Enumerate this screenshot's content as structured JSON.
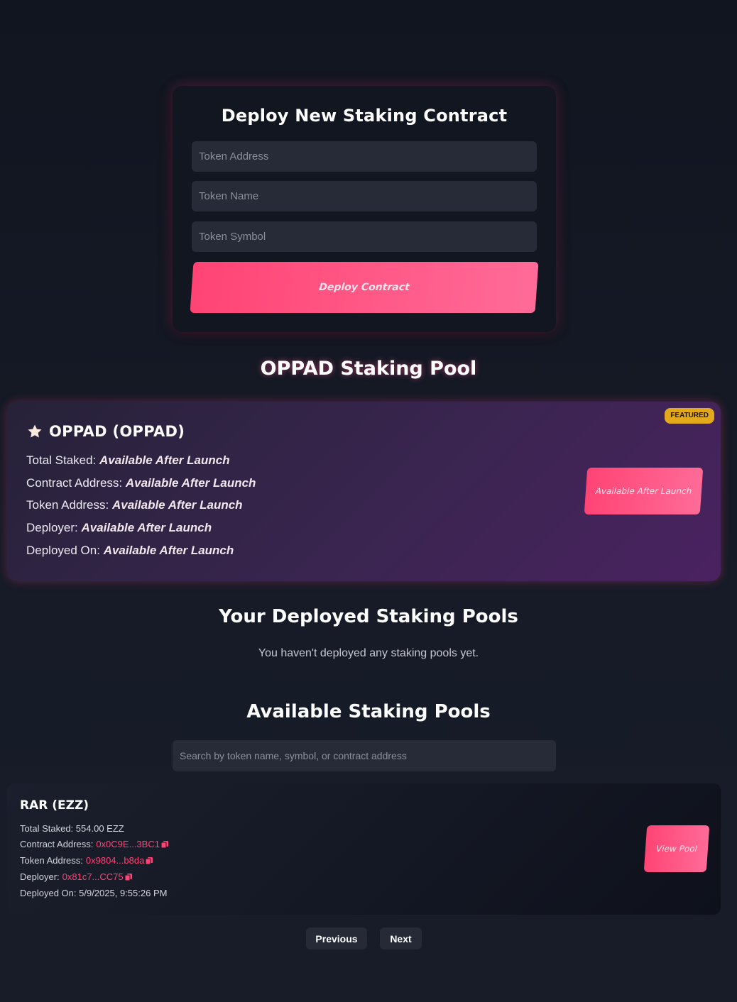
{
  "deploy": {
    "title": "Deploy New Staking Contract",
    "token_address_placeholder": "Token Address",
    "token_name_placeholder": "Token Name",
    "token_symbol_placeholder": "Token Symbol",
    "button_label": "Deploy Contract"
  },
  "featured": {
    "heading": "OPPAD Staking Pool",
    "badge": "FEATURED",
    "icon": "star-icon",
    "name": "OPPAD (OPPAD)",
    "rows": [
      {
        "label": "Total Staked:",
        "value": "Available After Launch"
      },
      {
        "label": "Contract Address:",
        "value": "Available After Launch"
      },
      {
        "label": "Token Address:",
        "value": "Available After Launch"
      },
      {
        "label": "Deployer:",
        "value": "Available After Launch"
      },
      {
        "label": "Deployed On:",
        "value": "Available After Launch"
      }
    ],
    "button_label": "Available After Launch"
  },
  "your_pools": {
    "heading": "Your Deployed Staking Pools",
    "empty_text": "You haven't deployed any staking pools yet."
  },
  "available": {
    "heading": "Available Staking Pools",
    "search_placeholder": "Search by token name, symbol, or contract address",
    "pools": [
      {
        "name": "RAR (EZZ)",
        "total_staked_label": "Total Staked:",
        "total_staked": "554.00 EZZ",
        "contract_label": "Contract Address:",
        "contract": "0x0C9E...3BC1",
        "token_label": "Token Address:",
        "token": "0x9804...b8da",
        "deployer_label": "Deployer:",
        "deployer": "0x81c7...CC75",
        "deployed_label": "Deployed On:",
        "deployed_on": "5/9/2025, 9:55:26 PM",
        "button_label": "View Pool"
      }
    ]
  },
  "pagination": {
    "previous": "Previous",
    "next": "Next"
  },
  "colors": {
    "accent": "#ff4474",
    "badge": "#e2a91c",
    "background": "#131722"
  }
}
